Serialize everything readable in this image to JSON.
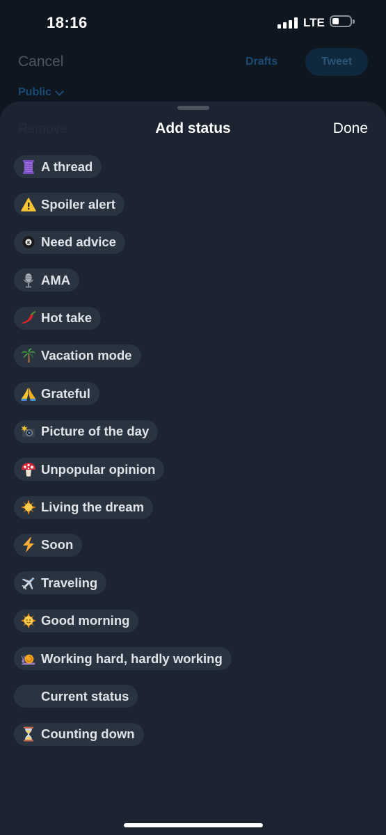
{
  "status_bar": {
    "time": "18:16",
    "network": "LTE"
  },
  "compose": {
    "cancel_label": "Cancel",
    "drafts_label": "Drafts",
    "tweet_label": "Tweet",
    "audience_label": "Public"
  },
  "sheet": {
    "remove_label": "Remove",
    "title": "Add status",
    "done_label": "Done"
  },
  "statuses": [
    {
      "label": "A thread",
      "icon": "thread-spool-icon"
    },
    {
      "label": "Spoiler alert",
      "icon": "warning-icon"
    },
    {
      "label": "Need advice",
      "icon": "eight-ball-icon"
    },
    {
      "label": "AMA",
      "icon": "microphone-icon"
    },
    {
      "label": "Hot take",
      "icon": "chili-pepper-icon"
    },
    {
      "label": "Vacation mode",
      "icon": "palm-tree-icon"
    },
    {
      "label": "Grateful",
      "icon": "folded-hands-icon"
    },
    {
      "label": "Picture of the day",
      "icon": "camera-flash-icon"
    },
    {
      "label": "Unpopular opinion",
      "icon": "mushroom-icon"
    },
    {
      "label": "Living the dream",
      "icon": "sun-icon"
    },
    {
      "label": "Soon",
      "icon": "lightning-icon"
    },
    {
      "label": "Traveling",
      "icon": "airplane-icon"
    },
    {
      "label": "Good morning",
      "icon": "sun-face-icon"
    },
    {
      "label": "Working hard, hardly working",
      "icon": "snail-icon"
    },
    {
      "label": "Current status",
      "icon": "checkmark-icon"
    },
    {
      "label": "Counting down",
      "icon": "hourglass-icon"
    }
  ],
  "colors": {
    "background": "#0e1620",
    "sheet": "#1b2430",
    "chip": "#2a3441",
    "chip_text": "#dfe3e8",
    "accent_dim": "#1c4a72"
  }
}
